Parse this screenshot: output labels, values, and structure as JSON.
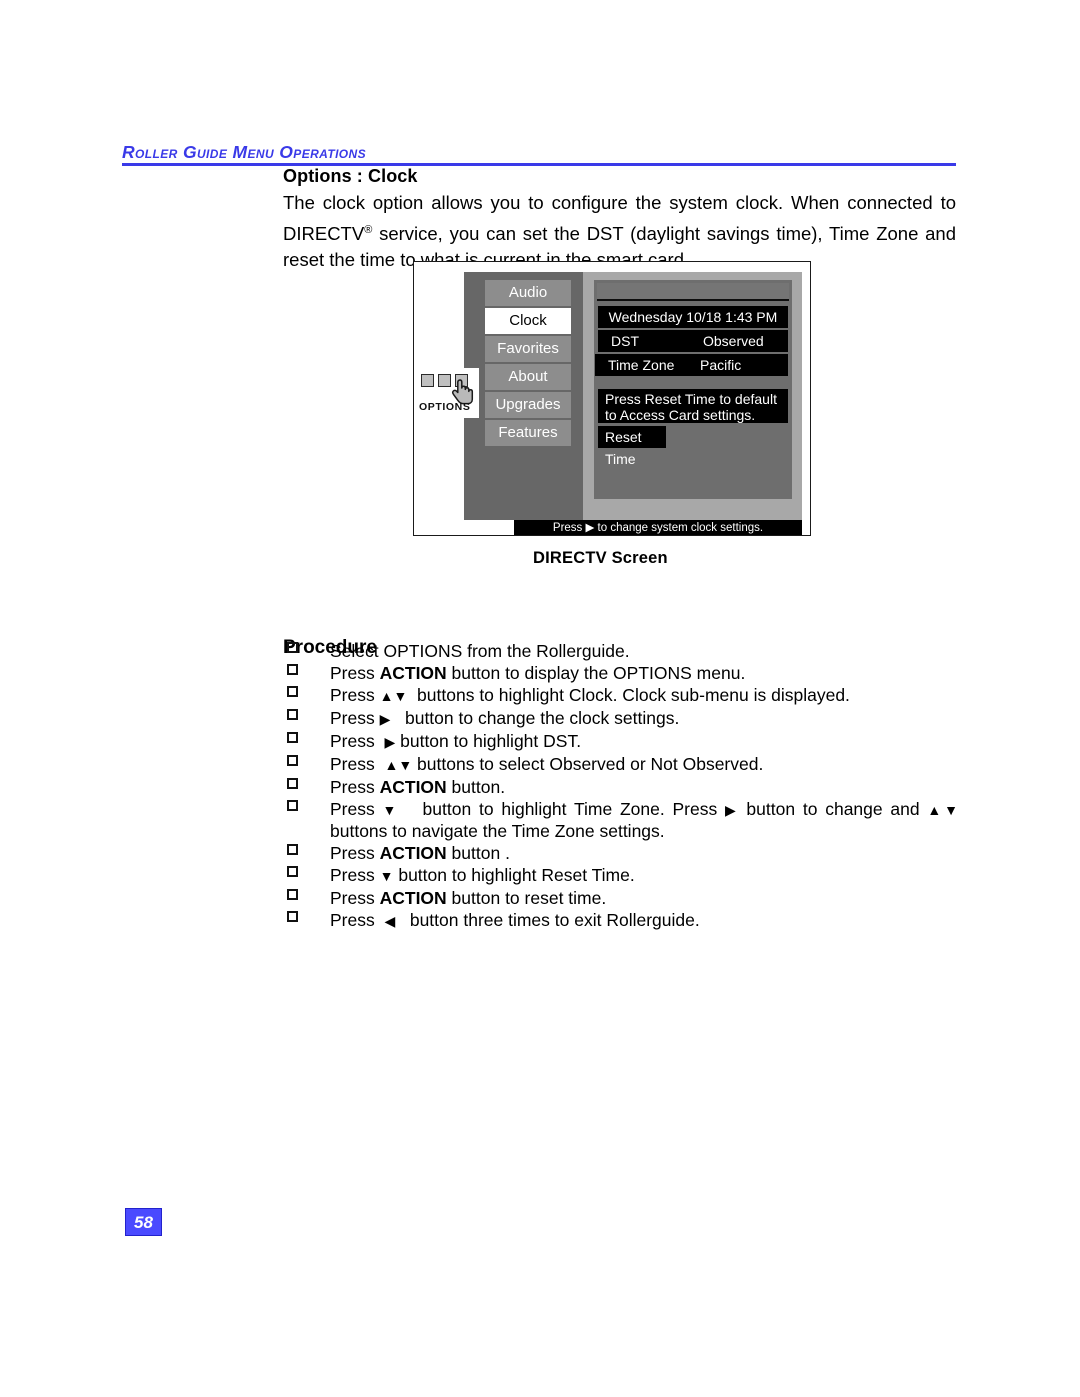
{
  "running_head": "Roller Guide Menu Operations",
  "accent_color": "#3a3ae8",
  "section": {
    "title": "Options : Clock",
    "paragraph_part1": "The clock option allows you to configure the system clock. When connected to DIRECTV",
    "registered_mark": "®",
    "paragraph_part2": " service, you can set the DST (daylight savings time), Time Zone and reset the time to what is current in the smart card."
  },
  "figure": {
    "caption": "DIRECTV Screen",
    "options_icon_label": "OPTIONS",
    "menu_items": [
      {
        "label": "Audio",
        "selected": false
      },
      {
        "label": "Clock",
        "selected": true
      },
      {
        "label": "Favorites",
        "selected": false
      },
      {
        "label": "About",
        "selected": false
      },
      {
        "label": "Upgrades",
        "selected": false
      },
      {
        "label": "Features",
        "selected": false
      }
    ],
    "panel": {
      "datetime": "Wednesday 10/18 1:43 PM",
      "dst_label": "DST",
      "dst_value": "Observed",
      "timezone_label": "Time Zone",
      "timezone_value": "Pacific",
      "hint": "Press Reset Time to default to Access Card settings.",
      "reset_button": "Reset Time"
    },
    "status_bar": "Press ▶ to change system clock settings."
  },
  "procedure": {
    "heading": "Procedure",
    "steps": [
      "Select OPTIONS from the Rollerguide.",
      "Press <b>ACTION</b> button to display the OPTIONS menu.",
      "Press <span class=\"arrow\">▲▼</span>&nbsp; buttons to highlight Clock. Clock sub-menu is displayed.",
      "Press <span class=\"arrow\">▶</span>&nbsp;&nbsp; button to change the clock settings.",
      "Press &nbsp;<span class=\"arrow\">▶</span> button to highlight DST.",
      "Press &nbsp;<span class=\"arrow\">▲▼</span> buttons to select Observed or Not Observed.",
      "Press <b>ACTION</b> button.",
      "Press <span class=\"arrow\">▼</span>&nbsp;&nbsp; button to highlight Time Zone. Press <span class=\"arrow\">▶</span> button to change and <span class=\"arrow\">▲▼</span> buttons to navigate the Time Zone settings.",
      "Press <b>ACTION</b> button .",
      "Press <span class=\"arrow\">▼</span> button to highlight Reset Time.",
      "Press <b>ACTION</b> button to reset time.",
      "Press &nbsp;<span class=\"arrow\">◀</span>&nbsp;&nbsp; button three times to exit Rollerguide."
    ]
  },
  "page_number": "58"
}
